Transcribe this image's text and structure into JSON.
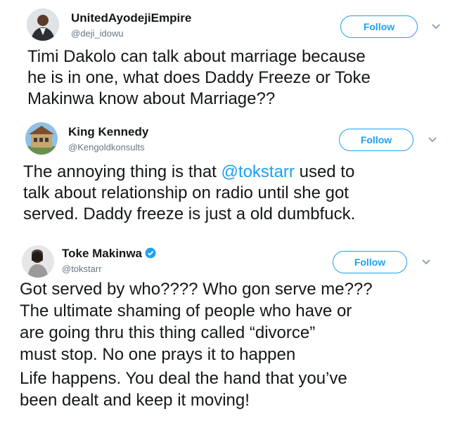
{
  "tweets": [
    {
      "name": "UnitedAyodejiEmpire",
      "handle": "@deji_idowu",
      "follow_label": "Follow",
      "lines": [
        "Timi Dakolo can talk about marriage because",
        "he is in one, what does Daddy Freeze or Toke",
        "Makinwa know about Marriage??"
      ]
    },
    {
      "name": "King Kennedy",
      "handle": "@Kengoldkonsults",
      "follow_label": "Follow",
      "line1_before": "The annoying thing is that ",
      "line1_mention": "@tokstarr",
      "line1_after": " used to",
      "lines": [
        "talk about relationship on radio until she got",
        "served. Daddy freeze is just a old dumbfuck."
      ]
    },
    {
      "name": "Toke Makinwa",
      "handle": "@tokstarr",
      "verified": true,
      "follow_label": "Follow",
      "lines": [
        "Got served by who???? Who gon serve me???",
        "The ultimate shaming of people who have or",
        "are going thru this thing called “divorce”",
        "must stop. No one prays it to happen",
        "Life happens. You deal the hand that you’ve",
        "been dealt and keep it moving!"
      ]
    }
  ],
  "colors": {
    "accent": "#1da1f2",
    "text": "#14171a",
    "secondary": "#657786"
  }
}
